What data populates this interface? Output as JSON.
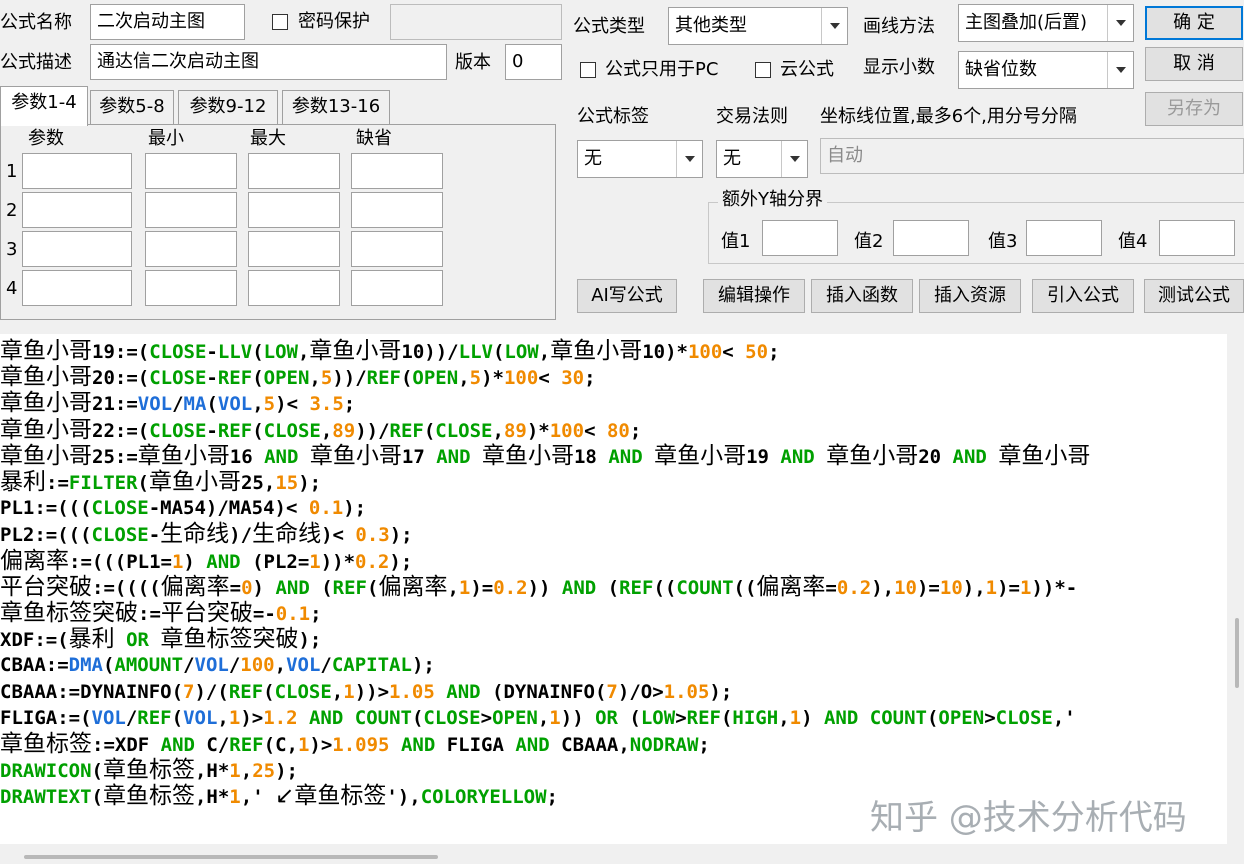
{
  "form": {
    "name_label": "公式名称",
    "name_value": "二次启动主图",
    "password_label": "密码保护",
    "password_value": "",
    "desc_label": "公式描述",
    "desc_value": "通达信二次启动主图",
    "version_label": "版本",
    "version_value": "0",
    "type_label": "公式类型",
    "type_value": "其他类型",
    "draw_label": "画线方法",
    "draw_value": "主图叠加(后置)",
    "pc_only_label": "公式只用于PC",
    "cloud_label": "云公式",
    "decimals_label": "显示小数",
    "decimals_value": "缺省位数",
    "tag_label": "公式标签",
    "tag_value": "无",
    "trade_rule_label": "交易法则",
    "trade_rule_value": "无",
    "coord_label": "坐标线位置,最多6个,用分号分隔",
    "coord_value": "自动"
  },
  "buttons": {
    "ok": "确 定",
    "cancel": "取 消",
    "save_as": "另存为",
    "ai": "AI写公式",
    "edit_ops": "编辑操作",
    "insert_func": "插入函数",
    "insert_res": "插入资源",
    "import_formula": "引入公式",
    "test_formula": "测试公式"
  },
  "tabs": [
    "参数1-4",
    "参数5-8",
    "参数9-12",
    "参数13-16"
  ],
  "params": {
    "headers": [
      "参数",
      "最小",
      "最大",
      "缺省"
    ],
    "rows": [
      "1",
      "2",
      "3",
      "4"
    ]
  },
  "yaxis": {
    "title": "额外Y轴分界",
    "labels": [
      "值1",
      "值2",
      "值3",
      "值4"
    ]
  },
  "code_lines": [
    [
      [
        "n",
        "章鱼小哥19:=("
      ],
      [
        "k",
        "CLOSE"
      ],
      [
        "n",
        "-"
      ],
      [
        "k",
        "LLV"
      ],
      [
        "n",
        "("
      ],
      [
        "k",
        "LOW"
      ],
      [
        "n",
        ",章鱼小哥10))/"
      ],
      [
        "k",
        "LLV"
      ],
      [
        "n",
        "("
      ],
      [
        "k",
        "LOW"
      ],
      [
        "n",
        ",章鱼小哥10)*"
      ],
      [
        "u",
        "100"
      ],
      [
        "n",
        "< "
      ],
      [
        "u",
        "50"
      ],
      [
        "n",
        ";"
      ]
    ],
    [
      [
        "n",
        "章鱼小哥20:=("
      ],
      [
        "k",
        "CLOSE"
      ],
      [
        "n",
        "-"
      ],
      [
        "k",
        "REF"
      ],
      [
        "n",
        "("
      ],
      [
        "k",
        "OPEN"
      ],
      [
        "n",
        ","
      ],
      [
        "u",
        "5"
      ],
      [
        "n",
        "))/"
      ],
      [
        "k",
        "REF"
      ],
      [
        "n",
        "("
      ],
      [
        "k",
        "OPEN"
      ],
      [
        "n",
        ","
      ],
      [
        "u",
        "5"
      ],
      [
        "n",
        ")*"
      ],
      [
        "u",
        "100"
      ],
      [
        "n",
        "< "
      ],
      [
        "u",
        "30"
      ],
      [
        "n",
        ";"
      ]
    ],
    [
      [
        "n",
        "章鱼小哥21:="
      ],
      [
        "f",
        "VOL"
      ],
      [
        "n",
        "/"
      ],
      [
        "f",
        "MA"
      ],
      [
        "n",
        "("
      ],
      [
        "f",
        "VOL"
      ],
      [
        "n",
        ","
      ],
      [
        "u",
        "5"
      ],
      [
        "n",
        ")< "
      ],
      [
        "u",
        "3.5"
      ],
      [
        "n",
        ";"
      ]
    ],
    [
      [
        "n",
        "章鱼小哥22:=("
      ],
      [
        "k",
        "CLOSE"
      ],
      [
        "n",
        "-"
      ],
      [
        "k",
        "REF"
      ],
      [
        "n",
        "("
      ],
      [
        "k",
        "CLOSE"
      ],
      [
        "n",
        ","
      ],
      [
        "u",
        "89"
      ],
      [
        "n",
        "))/"
      ],
      [
        "k",
        "REF"
      ],
      [
        "n",
        "("
      ],
      [
        "k",
        "CLOSE"
      ],
      [
        "n",
        ","
      ],
      [
        "u",
        "89"
      ],
      [
        "n",
        ")*"
      ],
      [
        "u",
        "100"
      ],
      [
        "n",
        "< "
      ],
      [
        "u",
        "80"
      ],
      [
        "n",
        ";"
      ]
    ],
    [
      [
        "n",
        "章鱼小哥25:=章鱼小哥16 "
      ],
      [
        "k",
        "AND"
      ],
      [
        "n",
        " 章鱼小哥17 "
      ],
      [
        "k",
        "AND"
      ],
      [
        "n",
        " 章鱼小哥18 "
      ],
      [
        "k",
        "AND"
      ],
      [
        "n",
        " 章鱼小哥19 "
      ],
      [
        "k",
        "AND"
      ],
      [
        "n",
        " 章鱼小哥20 "
      ],
      [
        "k",
        "AND"
      ],
      [
        "n",
        " 章鱼小哥"
      ]
    ],
    [
      [
        "n",
        "暴利:="
      ],
      [
        "k",
        "FILTER"
      ],
      [
        "n",
        "(章鱼小哥25,"
      ],
      [
        "u",
        "15"
      ],
      [
        "n",
        ");"
      ]
    ],
    [
      [
        "n",
        "PL1:=((("
      ],
      [
        "k",
        "CLOSE"
      ],
      [
        "n",
        "-MA54)/MA54)< "
      ],
      [
        "u",
        "0.1"
      ],
      [
        "n",
        ");"
      ]
    ],
    [
      [
        "n",
        "PL2:=((("
      ],
      [
        "k",
        "CLOSE"
      ],
      [
        "n",
        "-生命线)/生命线)< "
      ],
      [
        "u",
        "0.3"
      ],
      [
        "n",
        ");"
      ]
    ],
    [
      [
        "n",
        "偏离率:=(((PL1="
      ],
      [
        "u",
        "1"
      ],
      [
        "n",
        ") "
      ],
      [
        "k",
        "AND"
      ],
      [
        "n",
        " (PL2="
      ],
      [
        "u",
        "1"
      ],
      [
        "n",
        "))*"
      ],
      [
        "u",
        "0.2"
      ],
      [
        "n",
        ");"
      ]
    ],
    [
      [
        "n",
        "平台突破:=((((偏离率="
      ],
      [
        "u",
        "0"
      ],
      [
        "n",
        ") "
      ],
      [
        "k",
        "AND"
      ],
      [
        "n",
        " ("
      ],
      [
        "k",
        "REF"
      ],
      [
        "n",
        "(偏离率,"
      ],
      [
        "u",
        "1"
      ],
      [
        "n",
        ")="
      ],
      [
        "u",
        "0.2"
      ],
      [
        "n",
        ")) "
      ],
      [
        "k",
        "AND"
      ],
      [
        "n",
        " ("
      ],
      [
        "k",
        "REF"
      ],
      [
        "n",
        "(("
      ],
      [
        "k",
        "COUNT"
      ],
      [
        "n",
        "((偏离率="
      ],
      [
        "u",
        "0.2"
      ],
      [
        "n",
        "),"
      ],
      [
        "u",
        "10"
      ],
      [
        "n",
        ")="
      ],
      [
        "u",
        "10"
      ],
      [
        "n",
        "),"
      ],
      [
        "u",
        "1"
      ],
      [
        "n",
        ")="
      ],
      [
        "u",
        "1"
      ],
      [
        "n",
        "))*-"
      ]
    ],
    [
      [
        "n",
        "章鱼标签突破:=平台突破=-"
      ],
      [
        "u",
        "0.1"
      ],
      [
        "n",
        ";"
      ]
    ],
    [
      [
        "n",
        "XDF:=(暴利 "
      ],
      [
        "k",
        "OR"
      ],
      [
        "n",
        " 章鱼标签突破);"
      ]
    ],
    [
      [
        "n",
        "CBAA:="
      ],
      [
        "f",
        "DMA"
      ],
      [
        "n",
        "("
      ],
      [
        "k",
        "AMOUNT"
      ],
      [
        "n",
        "/"
      ],
      [
        "f",
        "VOL"
      ],
      [
        "n",
        "/"
      ],
      [
        "u",
        "100"
      ],
      [
        "n",
        ","
      ],
      [
        "f",
        "VOL"
      ],
      [
        "n",
        "/"
      ],
      [
        "k",
        "CAPITAL"
      ],
      [
        "n",
        ");"
      ]
    ],
    [
      [
        "n",
        "CBAAA:=DYNAINFO("
      ],
      [
        "u",
        "7"
      ],
      [
        "n",
        ")/("
      ],
      [
        "k",
        "REF"
      ],
      [
        "n",
        "("
      ],
      [
        "k",
        "CLOSE"
      ],
      [
        "n",
        ","
      ],
      [
        "u",
        "1"
      ],
      [
        "n",
        "))>"
      ],
      [
        "u",
        "1.05"
      ],
      [
        "n",
        " "
      ],
      [
        "k",
        "AND"
      ],
      [
        "n",
        " (DYNAINFO("
      ],
      [
        "u",
        "7"
      ],
      [
        "n",
        ")/O>"
      ],
      [
        "u",
        "1.05"
      ],
      [
        "n",
        ");"
      ]
    ],
    [
      [
        "n",
        "FLIGA:=("
      ],
      [
        "f",
        "VOL"
      ],
      [
        "n",
        "/"
      ],
      [
        "k",
        "REF"
      ],
      [
        "n",
        "("
      ],
      [
        "f",
        "VOL"
      ],
      [
        "n",
        ","
      ],
      [
        "u",
        "1"
      ],
      [
        "n",
        ")>"
      ],
      [
        "u",
        "1.2"
      ],
      [
        "n",
        " "
      ],
      [
        "k",
        "AND"
      ],
      [
        "n",
        " "
      ],
      [
        "k",
        "COUNT"
      ],
      [
        "n",
        "("
      ],
      [
        "k",
        "CLOSE"
      ],
      [
        "n",
        ">"
      ],
      [
        "k",
        "OPEN"
      ],
      [
        "n",
        ","
      ],
      [
        "u",
        "1"
      ],
      [
        "n",
        ")) "
      ],
      [
        "k",
        "OR"
      ],
      [
        "n",
        " ("
      ],
      [
        "k",
        "LOW"
      ],
      [
        "n",
        ">"
      ],
      [
        "k",
        "REF"
      ],
      [
        "n",
        "("
      ],
      [
        "k",
        "HIGH"
      ],
      [
        "n",
        ","
      ],
      [
        "u",
        "1"
      ],
      [
        "n",
        ") "
      ],
      [
        "k",
        "AND"
      ],
      [
        "n",
        " "
      ],
      [
        "k",
        "COUNT"
      ],
      [
        "n",
        "("
      ],
      [
        "k",
        "OPEN"
      ],
      [
        "n",
        ">"
      ],
      [
        "k",
        "CLOSE"
      ],
      [
        "n",
        ",'"
      ]
    ],
    [
      [
        "n",
        "章鱼标签:=XDF "
      ],
      [
        "k",
        "AND"
      ],
      [
        "n",
        " C/"
      ],
      [
        "k",
        "REF"
      ],
      [
        "n",
        "(C,"
      ],
      [
        "u",
        "1"
      ],
      [
        "n",
        ")>"
      ],
      [
        "u",
        "1.095"
      ],
      [
        "n",
        " "
      ],
      [
        "k",
        "AND"
      ],
      [
        "n",
        " FLIGA "
      ],
      [
        "k",
        "AND"
      ],
      [
        "n",
        " CBAAA,"
      ],
      [
        "k",
        "NODRAW"
      ],
      [
        "n",
        ";"
      ]
    ],
    [
      [
        "k",
        "DRAWICON"
      ],
      [
        "n",
        "(章鱼标签,H*"
      ],
      [
        "u",
        "1"
      ],
      [
        "n",
        ","
      ],
      [
        "u",
        "25"
      ],
      [
        "n",
        ");"
      ]
    ],
    [
      [
        "k",
        "DRAWTEXT"
      ],
      [
        "n",
        "(章鱼标签,H*"
      ],
      [
        "u",
        "1"
      ],
      [
        "n",
        ",' ↙章鱼标签'),"
      ],
      [
        "k",
        "COLORYELLOW"
      ],
      [
        "n",
        ";"
      ]
    ]
  ],
  "watermark": "知乎 @技术分析代码"
}
